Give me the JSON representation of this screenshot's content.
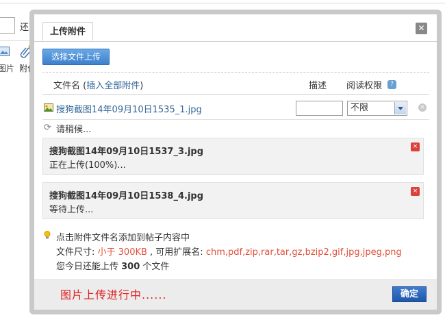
{
  "background": {
    "partial_text": "还可",
    "toolbar": [
      {
        "label": "图片",
        "icon": "image-icon"
      },
      {
        "label": "附件",
        "icon": "paperclip-icon"
      }
    ]
  },
  "dialog": {
    "tab_title": "上传附件",
    "close_icon": "close-icon",
    "upload_button": "选择文件上传",
    "columns": {
      "filename_label": "文件名",
      "insert_all_open": "(",
      "insert_all": "插入全部附件",
      "insert_all_close": ")",
      "description": "描述",
      "read_permission": "阅读权限",
      "help_icon": "?"
    },
    "file_row": {
      "icon": "image-file-icon",
      "name": "搜狗截图14年09月10日1535_1.jpg",
      "description_value": "",
      "permission_selected": "不限",
      "remove_icon": "×"
    },
    "waiting_text": "请稍候...",
    "uploads": [
      {
        "name": "搜狗截图14年09月10日1537_3.jpg",
        "status": "正在上传(100%)...",
        "cancel_icon": "×"
      },
      {
        "name": "搜狗截图14年09月10日1538_4.jpg",
        "status": "等待上传...",
        "cancel_icon": "×"
      }
    ],
    "tips": {
      "line1": "点击附件文件名添加到帖子内容中",
      "size_label": "文件尺寸: ",
      "size_value": "小于 300KB",
      "ext_label": " , 可用扩展名: ",
      "ext_value": "chm,pdf,zip,rar,tar,gz,bzip2,gif,jpg,jpeg,png",
      "today_prefix": "您今日还能上传 ",
      "today_count": "300",
      "today_suffix": " 个文件"
    },
    "footer": {
      "message": "图片上传进行中......",
      "ok_button": "确定"
    }
  },
  "colors": {
    "link": "#336699",
    "accent_red": "#e0503c",
    "footer_message": "#e02020",
    "button_blue": "#1f57aa"
  }
}
